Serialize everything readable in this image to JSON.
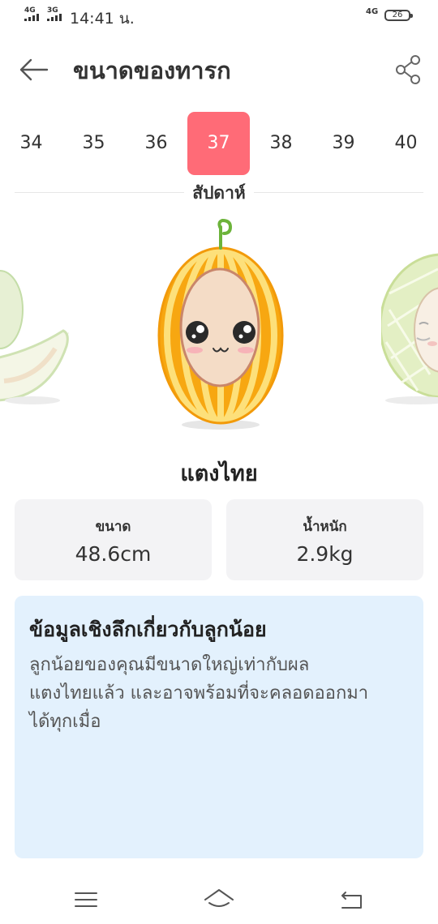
{
  "status_bar": {
    "signal1": "4G",
    "signal2": "3G",
    "time": "14:41 น.",
    "network_right": "4G",
    "battery": "26"
  },
  "header": {
    "title": "ขนาดของทารก",
    "back_icon": "arrow-left-icon",
    "share_icon": "share-icon"
  },
  "weeks": {
    "items": [
      "34",
      "35",
      "36",
      "37",
      "38",
      "39",
      "40"
    ],
    "selected": "37",
    "caption": "สัปดาห์"
  },
  "colors": {
    "accent": "#ff6b77",
    "card_bg": "#f3f3f5",
    "insight_bg": "#e3f1fd"
  },
  "fruit": {
    "name": "แตงไทย"
  },
  "stats": {
    "size_label": "ขนาด",
    "size_value": "48.6cm",
    "weight_label": "น้ำหนัก",
    "weight_value": "2.9kg"
  },
  "insight": {
    "title": "ข้อมูลเชิงลึกเกี่ยวกับลูกน้อย",
    "line1": "ลูกน้อยของคุณมีขนาดใหญ่เท่ากับผล",
    "line2": "แตงไทยแล้ว และอาจพร้อมที่จะคลอดออกมา",
    "line3": "ได้ทุกเมื่อ"
  },
  "navbar": {
    "menu_icon": "menu-icon",
    "home_icon": "home-icon",
    "back_icon": "back-icon"
  }
}
